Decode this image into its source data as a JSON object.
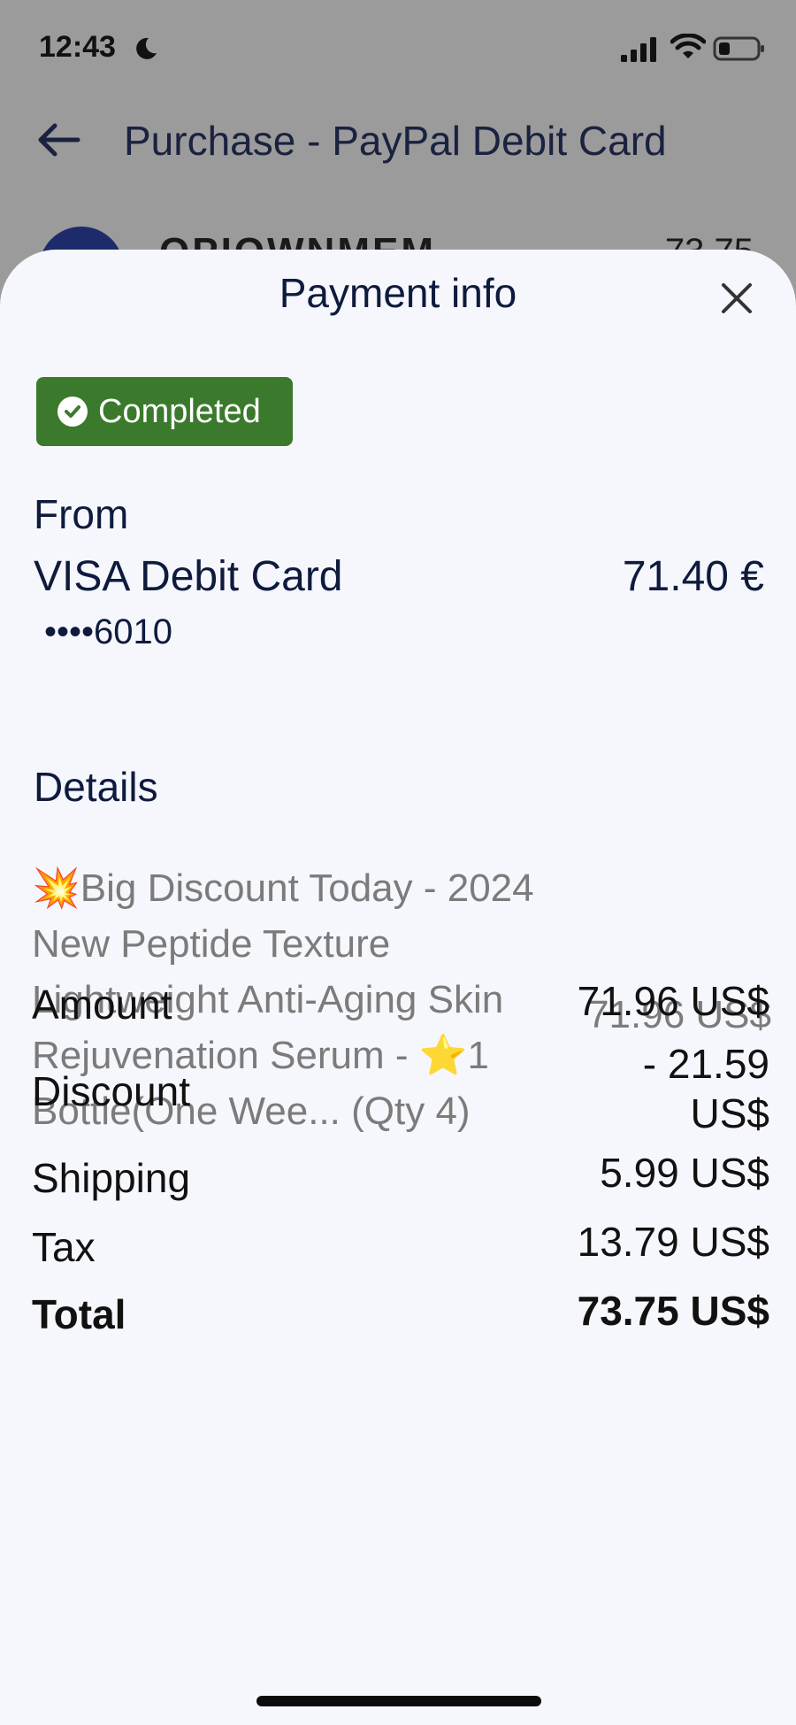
{
  "status_bar": {
    "time": "12:43"
  },
  "background": {
    "title": "Purchase - PayPal Debit Card",
    "merchant_name": "OPIOWNMEM",
    "amount": "73.75"
  },
  "sheet": {
    "title": "Payment info",
    "status_badge": "Completed",
    "from": {
      "label": "From",
      "card_name": "VISA Debit Card",
      "card_amount": "71.40 €",
      "card_number": "••••6010"
    },
    "details": {
      "label": "Details",
      "item_description": "💥Big Discount Today - 2024 New Peptide Texture Lightweight Anti-Aging Skin Rejuvenation Serum - ⭐1 Bottle(One Wee... (Qty 4)",
      "item_price": "71.96 US$"
    },
    "summary": {
      "amount_label": "Amount",
      "amount_value": "71.96 US$",
      "discount_label": "Discount",
      "discount_value_line1": "- 21.59",
      "discount_value_line2": "US$",
      "shipping_label": "Shipping",
      "shipping_value": "5.99 US$",
      "tax_label": "Tax",
      "tax_value": "13.79 US$",
      "total_label": "Total",
      "total_value": "73.75 US$"
    }
  },
  "colors": {
    "badge": "#3b7a2c",
    "primary_text": "#0e1b3d",
    "muted_text": "#7b7b7b"
  }
}
